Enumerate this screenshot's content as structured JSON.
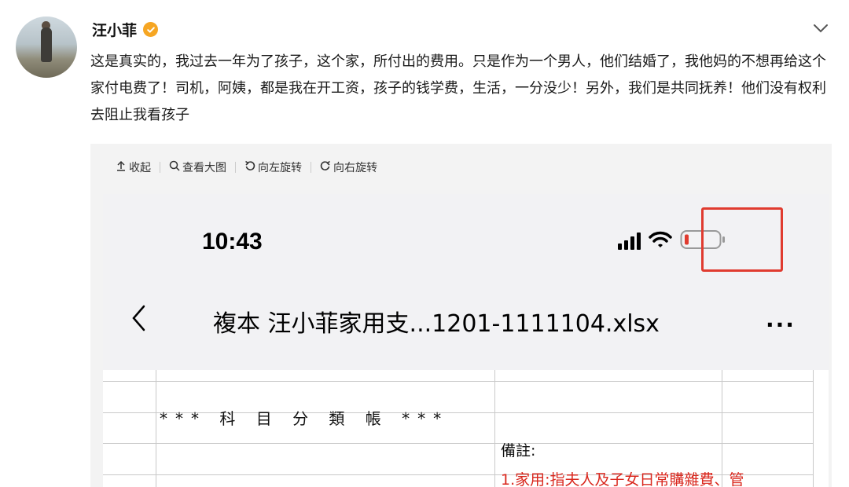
{
  "post": {
    "username": "汪小菲",
    "text": "这是真实的，我过去一年为了孩子，这个家，所付出的费用。只是作为一个男人，他们结婚了，我他妈的不想再给这个家付电费了！司机，阿姨，都是我在开工资，孩子的钱学费，生活，一分没少！另外，我们是共同抚养！他们没有权利去阻止我看孩子"
  },
  "toolbar": {
    "collapse": "收起",
    "view_large": "查看大图",
    "rotate_left": "向左旋转",
    "rotate_right": "向右旋转"
  },
  "screenshot": {
    "time": "10:43",
    "file_title": "複本 汪小菲家用支...1201-1111104.xlsx",
    "more": "···",
    "heading": "*** 科 目 分 類 帳 ***",
    "note_label": "備註:",
    "note_red": "1.家用:指夫人及子女日常購雜費、管"
  },
  "colors": {
    "verified_badge": "#f6a623",
    "highlight_box": "#e03b2f",
    "battery_low": "#e03b2f",
    "note_red": "#d9261c"
  },
  "icons": [
    "verified-icon",
    "chevron-down-icon",
    "collapse-icon",
    "search-icon",
    "rotate-left-icon",
    "rotate-right-icon",
    "back-icon",
    "signal-icon",
    "wifi-icon",
    "battery-icon",
    "more-icon"
  ]
}
